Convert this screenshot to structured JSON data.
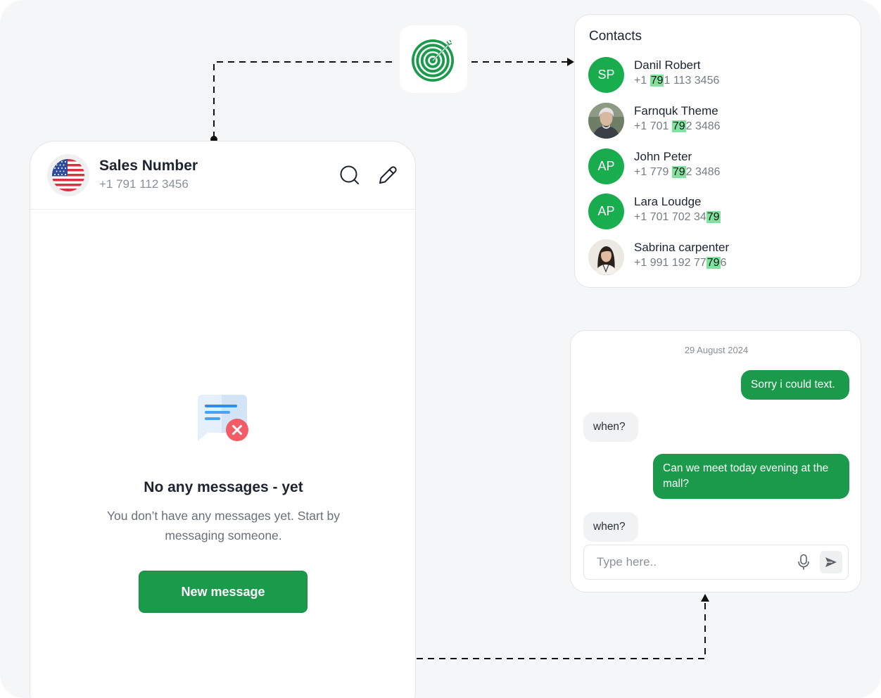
{
  "phone": {
    "title": "Sales Number",
    "number": "+1 791 112 3456",
    "empty_title": "No any messages - yet",
    "empty_description": "You don’t have any messages yet. Start by messaging someone.",
    "new_message_label": "New message"
  },
  "contacts": {
    "title": "Contacts",
    "items": [
      {
        "name": "Danil Robert",
        "avatar": "SP",
        "phone_pre": "+1 ",
        "phone_hl": "79",
        "phone_post": "1 113 3456"
      },
      {
        "name": "Farnquk Theme",
        "avatar": "photo-elderly-man",
        "phone_pre": "+1 701 ",
        "phone_hl": "79",
        "phone_post": "2 3486"
      },
      {
        "name": "John Peter",
        "avatar": "AP",
        "phone_pre": "+1 779 ",
        "phone_hl": "79",
        "phone_post": "2 3486"
      },
      {
        "name": "Lara Loudge",
        "avatar": "AP",
        "phone_pre": "+1 701 702 34",
        "phone_hl": "79",
        "phone_post": ""
      },
      {
        "name": "Sabrina carpenter",
        "avatar": "photo-woman",
        "phone_pre": "+1 991 192 77",
        "phone_hl": "79",
        "phone_post": "6"
      }
    ]
  },
  "chat": {
    "date": "29 August 2024",
    "messages": [
      {
        "direction": "out",
        "text": "Sorry i could text."
      },
      {
        "direction": "in",
        "text": "when?"
      },
      {
        "direction": "out",
        "text": "Can we meet today evening at the mall?"
      },
      {
        "direction": "in",
        "text": "when?"
      }
    ],
    "input_placeholder": "Type here.."
  },
  "colors": {
    "accent_green": "#1a9a4a",
    "highlight_green": "#7fe3a0",
    "canvas": "#f5f6f7"
  },
  "icons": [
    "target-icon",
    "us-flag-icon",
    "search-icon",
    "edit-icon",
    "message-error-icon",
    "mic-icon",
    "send-icon"
  ]
}
